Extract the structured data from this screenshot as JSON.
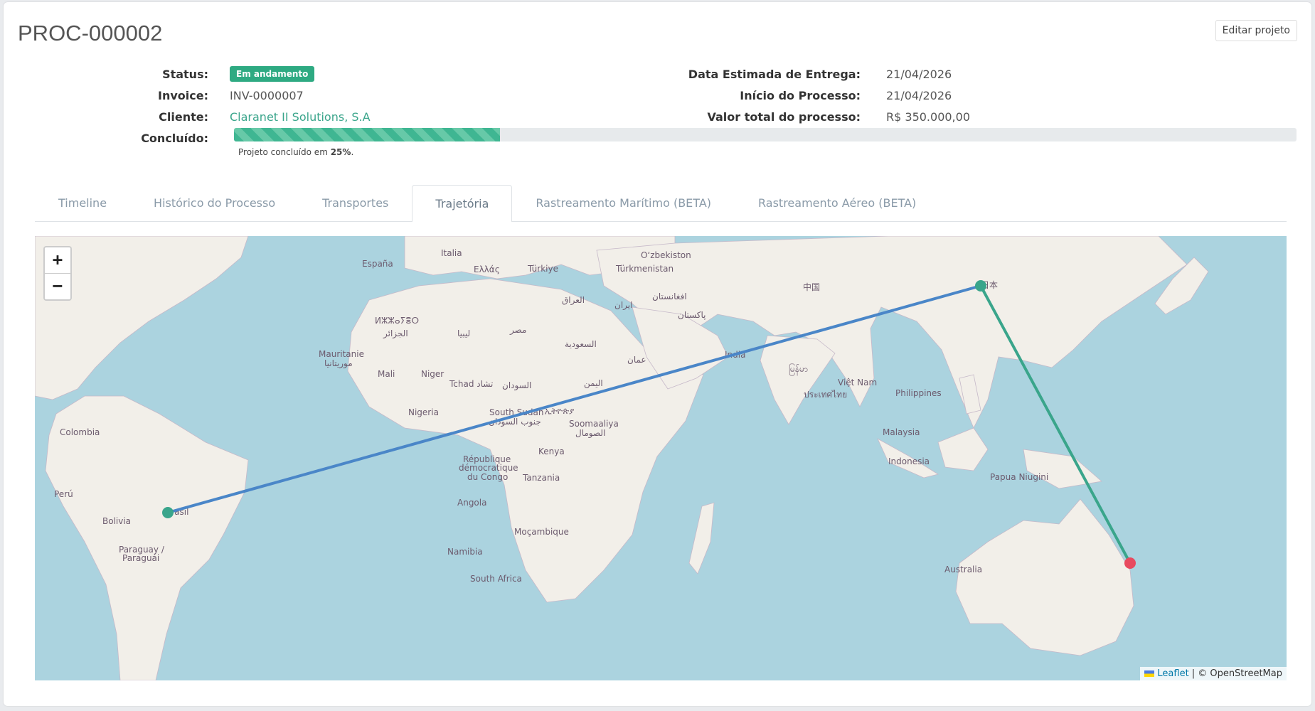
{
  "header": {
    "title": "PROC-000002",
    "edit_label": "Editar projeto"
  },
  "details_left": {
    "status_label": "Status:",
    "status_value": "Em andamento",
    "invoice_label": "Invoice:",
    "invoice_value": "INV-0000007",
    "client_label": "Cliente:",
    "client_value": "Claranet II Solutions, S.A",
    "done_label": "Concluído:"
  },
  "details_right": {
    "delivery_label": "Data Estimada de Entrega:",
    "delivery_value": "21/04/2026",
    "start_label": "Início do Processo:",
    "start_value": "21/04/2026",
    "total_label": "Valor total do processo:",
    "total_value": "R$ 350.000,00"
  },
  "progress": {
    "percent": 25,
    "text_prefix": "Projeto concluído em ",
    "text_value": "25%",
    "text_suffix": "."
  },
  "tabs": [
    {
      "label": "Timeline"
    },
    {
      "label": "Histórico do Processo"
    },
    {
      "label": "Transportes"
    },
    {
      "label": "Trajetória",
      "active": true
    },
    {
      "label": "Rastreamento Marítimo (BETA)"
    },
    {
      "label": "Rastreamento Aéreo (BETA)"
    }
  ],
  "map": {
    "zoom_in": "+",
    "zoom_out": "−",
    "attribution_link": "Leaflet",
    "attribution_text": "| © OpenStreetMap",
    "route_colors": {
      "leg1": "#4a86c8",
      "leg2": "#3aa58b",
      "origin": "#3aa58b",
      "destination": "#e84a5f"
    },
    "labels": {
      "espana": "España",
      "italia": "Italia",
      "ellas": "Ελλάς",
      "turkiye": "Türkiye",
      "uzbekistan": "O‘zbekiston",
      "turkmenistan": "Türkmenistan",
      "china": "中国",
      "japan": "日本",
      "iraq": "العراق",
      "iran": "ایران",
      "afghanistan": "افغانستان",
      "pakistan": "پاکستان",
      "algeria1": "ⵍⵣⵣⴰⵢⴻⵔ",
      "algeria2": "الجزائر",
      "libya": "ليبيا",
      "misr": "مصر",
      "saudi": "السعودية",
      "oman": "عمان",
      "yemen": "اليمن",
      "mauritanie": "Mauritanie",
      "mauritanie_ar": "موريتانيا",
      "mali": "Mali",
      "niger": "Niger",
      "tchad": "Tchad تشاد",
      "sudan": "السودان",
      "india": "India",
      "myanmar": "မြန်မာ",
      "vietnam": "Việt Nam",
      "thailand": "ประเทศไทย",
      "philippines": "Philippines",
      "nigeria": "Nigeria",
      "south_sudan": "South Sudan",
      "south_sudan_ar": "جنوب السودان",
      "ethiopia": "ኢትዮጵያ",
      "somalia": "Soomaaliya",
      "somalia_ar": "الصومال",
      "kenya": "Kenya",
      "rdc1": "République",
      "rdc2": "démocratique",
      "rdc3": "du Congo",
      "tanzania": "Tanzania",
      "malaysia": "Malaysia",
      "indonesia": "Indonesia",
      "papua": "Papua Niugini",
      "colombia": "Colombia",
      "peru": "Perú",
      "brasil": "Brasil",
      "bolivia": "Bolivia",
      "paraguay1": "Paraguay /",
      "paraguay2": "Paraguái",
      "angola": "Angola",
      "mocambique": "Moçambique",
      "namibia": "Namibia",
      "south_africa": "South Africa",
      "australia": "Australia"
    }
  }
}
